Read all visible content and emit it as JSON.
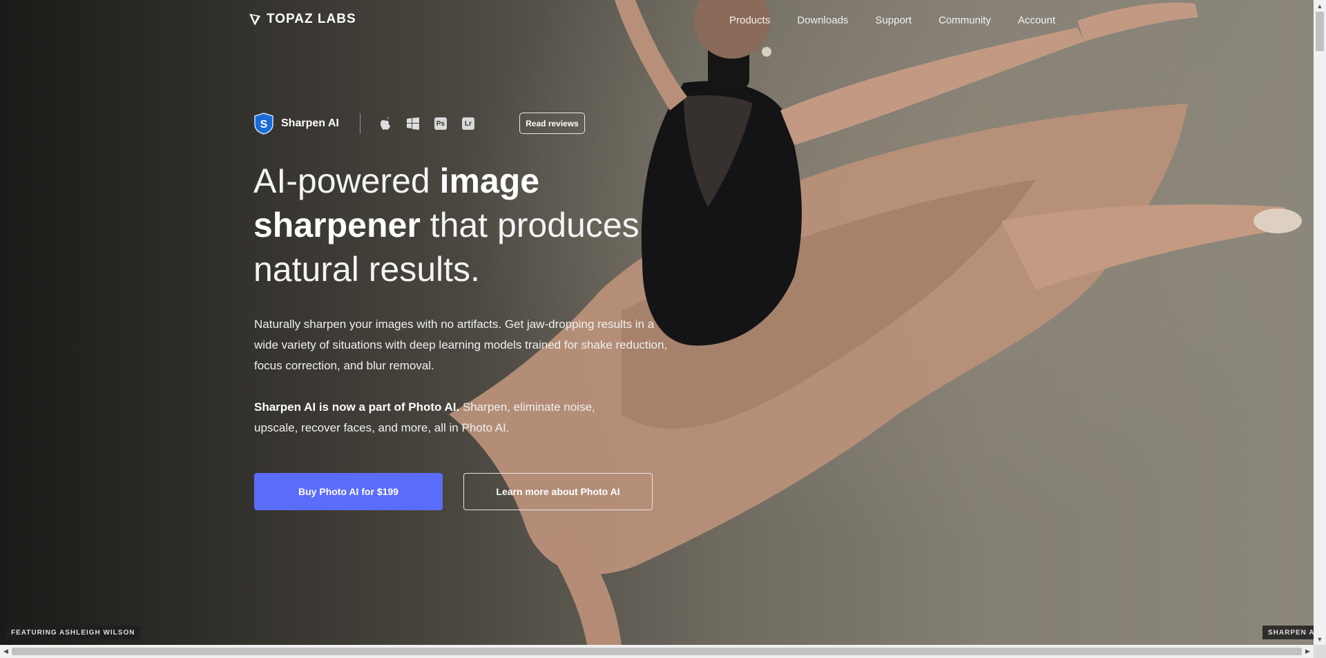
{
  "nav": {
    "logo_text": "TOPAZ LABS",
    "links": [
      "Products",
      "Downloads",
      "Support",
      "Community",
      "Account"
    ]
  },
  "product": {
    "name": "Sharpen AI",
    "platform_badges": [
      "Ps",
      "Lr"
    ],
    "reviews_label": "Read reviews"
  },
  "headline": {
    "part1": "AI-powered ",
    "bold1": "image sharpener",
    "part2": " that produces natural results."
  },
  "description": "Naturally sharpen your images with no artifacts. Get jaw-dropping results in a wide variety of situations with deep learning models trained for shake reduction, focus correction, and blur removal.",
  "notice": {
    "bold": "Sharpen AI is now a part of Photo AI.",
    "rest": " Sharpen, eliminate noise, upscale, recover faces, and more, all in Photo AI."
  },
  "cta": {
    "buy_label": "Buy Photo AI for $199",
    "learn_label": "Learn more about Photo AI"
  },
  "captions": {
    "left": "FEATURING ASHLEIGH WILSON",
    "right": "SHARPEN AI"
  },
  "colors": {
    "accent": "#5c6cfa",
    "brand_icon": "#1a6bd6"
  }
}
